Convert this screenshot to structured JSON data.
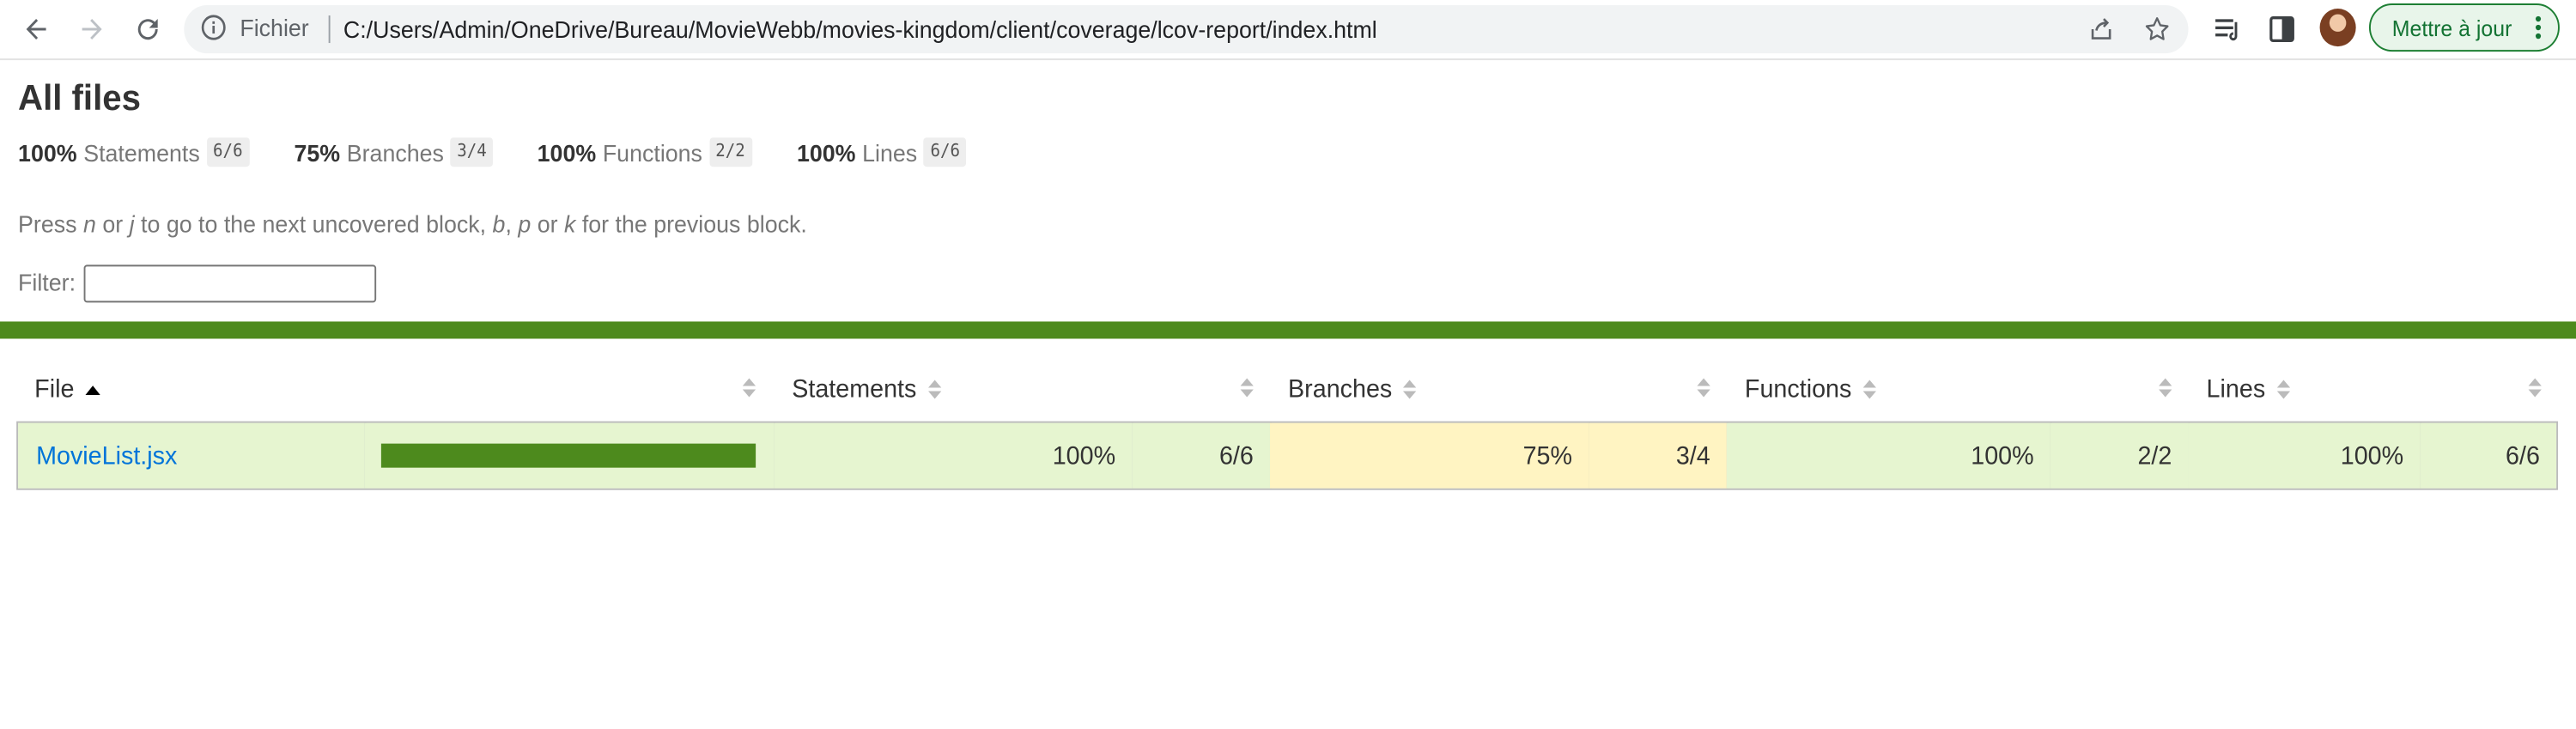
{
  "browser": {
    "site_label": "Fichier",
    "url": "C:/Users/Admin/OneDrive/Bureau/MovieWebb/movies-kingdom/client/coverage/lcov-report/index.html",
    "update_button": "Mettre à jour",
    "accent": "#137333"
  },
  "report": {
    "title": "All files",
    "summary": [
      {
        "pct": "100%",
        "label": "Statements",
        "fraction": "6/6"
      },
      {
        "pct": "75%",
        "label": "Branches",
        "fraction": "3/4"
      },
      {
        "pct": "100%",
        "label": "Functions",
        "fraction": "2/2"
      },
      {
        "pct": "100%",
        "label": "Lines",
        "fraction": "6/6"
      }
    ],
    "hint": {
      "t1": "Press ",
      "k1": "n",
      "t2": " or ",
      "k2": "j",
      "t3": " to go to the next uncovered block, ",
      "k3": "b",
      "t4": ", ",
      "k4": "p",
      "t5": " or ",
      "k5": "k",
      "t6": " for the previous block."
    },
    "filter_label": "Filter:",
    "filter_value": "",
    "status_color": "#4d8a1d"
  },
  "table": {
    "headers": {
      "file": "File",
      "statements": "Statements",
      "branches": "Branches",
      "functions": "Functions",
      "lines": "Lines"
    },
    "rows": [
      {
        "file": "MovieList.jsx",
        "coverage_fraction": 1.0,
        "statements_pct": "100%",
        "statements_frac": "6/6",
        "branches_pct": "75%",
        "branches_frac": "3/4",
        "functions_pct": "100%",
        "functions_frac": "2/2",
        "lines_pct": "100%",
        "lines_frac": "6/6"
      }
    ]
  }
}
